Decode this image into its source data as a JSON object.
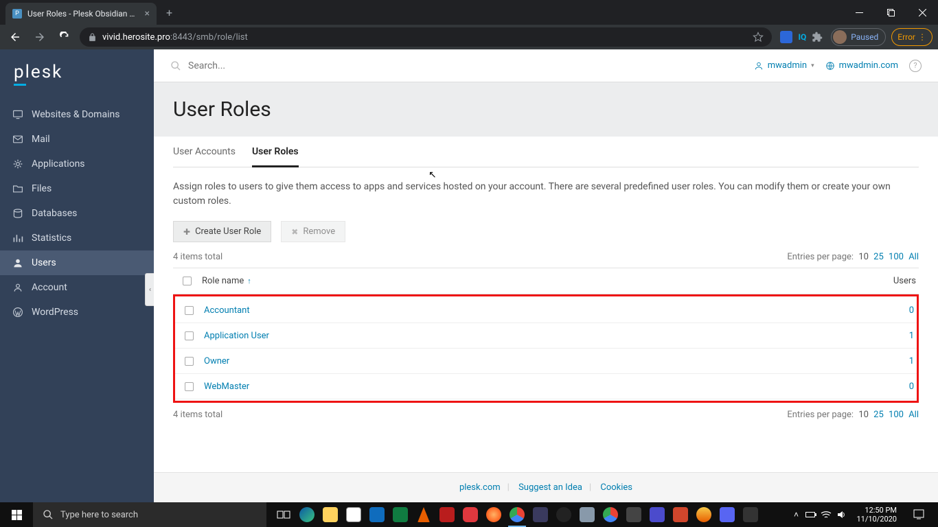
{
  "browser": {
    "tab_title": "User Roles - Plesk Obsidian 18.0...",
    "url_host": "vivid.herosite.pro",
    "url_rest": ":8443/smb/role/list",
    "paused": "Paused",
    "error": "Error"
  },
  "sidebar": {
    "logo": "plesk",
    "items": [
      {
        "label": "Websites & Domains",
        "icon": "monitor"
      },
      {
        "label": "Mail",
        "icon": "mail"
      },
      {
        "label": "Applications",
        "icon": "gear"
      },
      {
        "label": "Files",
        "icon": "folder"
      },
      {
        "label": "Databases",
        "icon": "db"
      },
      {
        "label": "Statistics",
        "icon": "stats"
      },
      {
        "label": "Users",
        "icon": "user",
        "active": true
      },
      {
        "label": "Account",
        "icon": "account"
      },
      {
        "label": "WordPress",
        "icon": "wp"
      }
    ]
  },
  "topbar": {
    "search_placeholder": "Search...",
    "user": "mwadmin",
    "domain": "mwadmin.com"
  },
  "page": {
    "title": "User Roles",
    "tabs": [
      {
        "label": "User Accounts"
      },
      {
        "label": "User Roles",
        "active": true
      }
    ],
    "description": "Assign roles to users to give them access to apps and services hosted on your account. There are several predefined user roles. You can modify them or create your own custom roles.",
    "btn_create": "Create User Role",
    "btn_remove": "Remove",
    "items_total": "4 items total",
    "entries_label": "Entries per page:",
    "entries_options": [
      "10",
      "25",
      "100",
      "All"
    ],
    "entries_current": "10",
    "columns": {
      "name": "Role name",
      "users": "Users"
    },
    "rows": [
      {
        "name": "Accountant",
        "users": "0"
      },
      {
        "name": "Application User",
        "users": "1"
      },
      {
        "name": "Owner",
        "users": "1"
      },
      {
        "name": "WebMaster",
        "users": "0"
      }
    ]
  },
  "footer": {
    "links": [
      "plesk.com",
      "Suggest an Idea",
      "Cookies"
    ]
  },
  "taskbar": {
    "search_placeholder": "Type here to search",
    "time": "12:50 PM",
    "date": "11/10/2020"
  }
}
